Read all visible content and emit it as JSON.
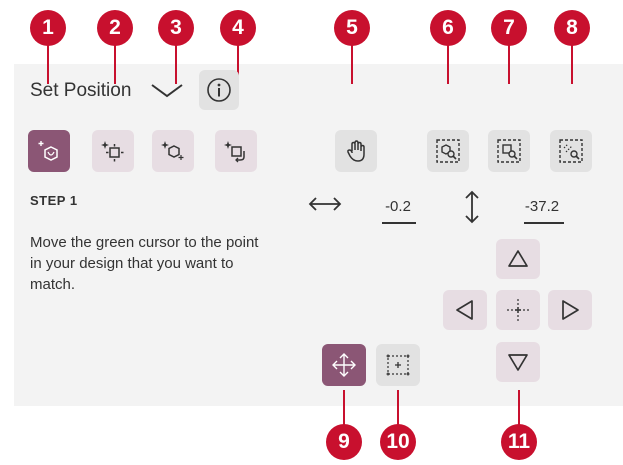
{
  "callouts": [
    "1",
    "2",
    "3",
    "4",
    "5",
    "6",
    "7",
    "8",
    "9",
    "10",
    "11"
  ],
  "header": {
    "title": "Set Position"
  },
  "tools": [
    {
      "icon": "set-position-sparkle-shape-icon"
    },
    {
      "icon": "move-sparkle-square-icon"
    },
    {
      "icon": "match-point-sparkle-icon"
    },
    {
      "icon": "rotate-sparkle-square-icon"
    }
  ],
  "content": {
    "step_label": "STEP 1",
    "description": "Move the green cursor to the point in your design that you want to match."
  },
  "position": {
    "x_value": "-0.2",
    "y_value": "-37.2"
  },
  "colors": {
    "accent": "#8b5675",
    "accent_light": "#e7dde3",
    "callout": "#c8102e",
    "panel": "#f3f3f3"
  }
}
